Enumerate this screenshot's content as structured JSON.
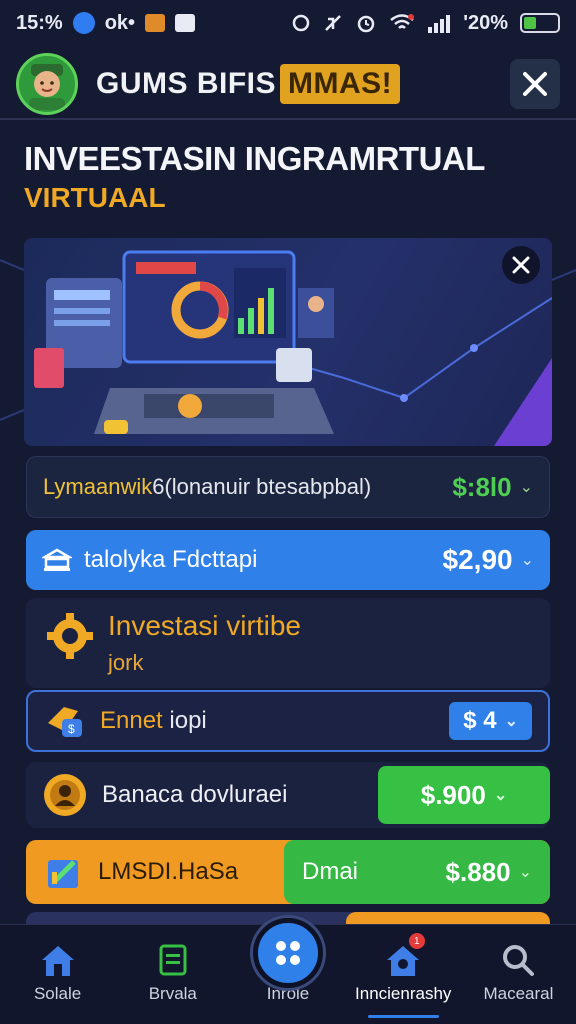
{
  "status_bar": {
    "time": "15:%",
    "carrier": "ok•",
    "battery_text": "'20%",
    "battery_level_pct": 20
  },
  "header": {
    "title": "GUMS BIFIS",
    "title_badge": "MMAS!",
    "close_symbol": "✕"
  },
  "page": {
    "title": "INVEESTASIN INGRAMRTUAL",
    "subtitle": "VIRTUAAL"
  },
  "banner": {
    "close_symbol": "✕"
  },
  "rows": {
    "row1": {
      "label_prefix": "Lymaanwik",
      "label_rest": "6(lonanuir btesabpbal)",
      "amount": "$:8l0"
    },
    "row2": {
      "label": "talolyka Fdcttapi",
      "amount": "$2,90"
    },
    "section": {
      "title": "Investasi virtibe",
      "subtitle": "jork"
    },
    "row3": {
      "label_prefix": "Ennet",
      "label_rest": " iopi",
      "amount": "$ 4"
    },
    "row4": {
      "label": "Banaca dovluraei",
      "amount": "$.900"
    },
    "row5": {
      "label": "LMSDI.HaSa",
      "name": "Dmai",
      "amount": "$.880"
    }
  },
  "nav": {
    "items": [
      {
        "label": "Solale",
        "icon": "home-icon"
      },
      {
        "label": "Brvala",
        "icon": "document-icon"
      },
      {
        "label": "Inrole",
        "icon": "grid-icon"
      },
      {
        "label": "Inncienrashy",
        "icon": "house-badge-icon",
        "badge": "1"
      },
      {
        "label": "Macearal",
        "icon": "search-icon"
      }
    ]
  },
  "chevron": "⌄",
  "colors": {
    "background": "#151a33",
    "accent_blue": "#2f80e8",
    "accent_green": "#36c044",
    "accent_orange": "#f19a21",
    "gold_text": "#f0a925"
  }
}
